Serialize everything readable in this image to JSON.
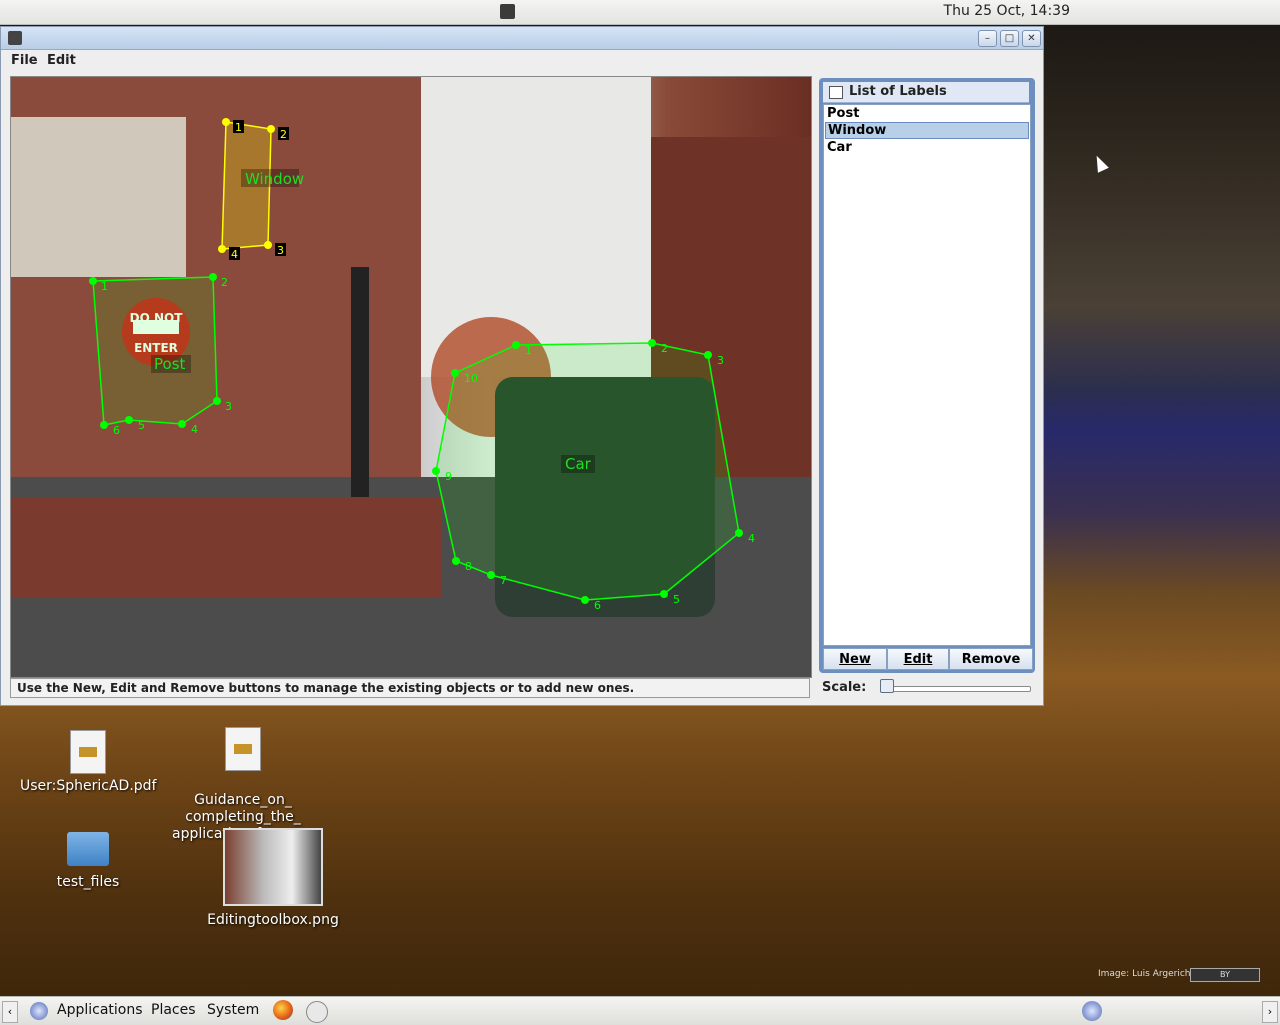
{
  "top_panel": {
    "clock": "Thu 25 Oct, 14:39"
  },
  "window": {
    "menu": {
      "file": "File",
      "edit": "Edit"
    },
    "status": "Use the New, Edit and Remove buttons to manage the existing objects or to add new ones.",
    "labels_panel": {
      "title": "List of Labels",
      "items": [
        "Post",
        "Window",
        "Car"
      ],
      "selected": "Window",
      "buttons": {
        "new": "New",
        "edit": "Edit",
        "remove": "Remove"
      }
    },
    "scale": {
      "label": "Scale:",
      "value": 0
    }
  },
  "canvas_annotations": {
    "window": {
      "label": "Window",
      "point_labels": [
        "1",
        "2",
        "3",
        "4"
      ],
      "color": "#ffff00"
    },
    "post": {
      "label": "Post",
      "point_labels": [
        "1",
        "2",
        "3",
        "4",
        "5",
        "6"
      ],
      "color": "#00ff00"
    },
    "car": {
      "label": "Car",
      "point_labels": [
        "1",
        "2",
        "3",
        "4",
        "5",
        "6",
        "7",
        "8",
        "9",
        "10"
      ],
      "color": "#00ff00"
    },
    "sign_text": [
      "DO NOT",
      "ENTER"
    ]
  },
  "desktop": {
    "icons": [
      {
        "name": "User:SphericAD.pdf"
      },
      {
        "name": "Guidance_on_\ncompleting_the_\napplication_forms...."
      },
      {
        "name": "test_files"
      },
      {
        "name": "Editingtoolbox.png"
      }
    ],
    "credit": "Image: Luis Argerich",
    "cc_badge": "BY"
  },
  "bottom_panel": {
    "applications": "Applications",
    "places": "Places",
    "system": "System"
  },
  "colors": {
    "accent": "#6d8fc0",
    "annotation_yellow": "#ffff00",
    "annotation_green": "#00ff00"
  }
}
